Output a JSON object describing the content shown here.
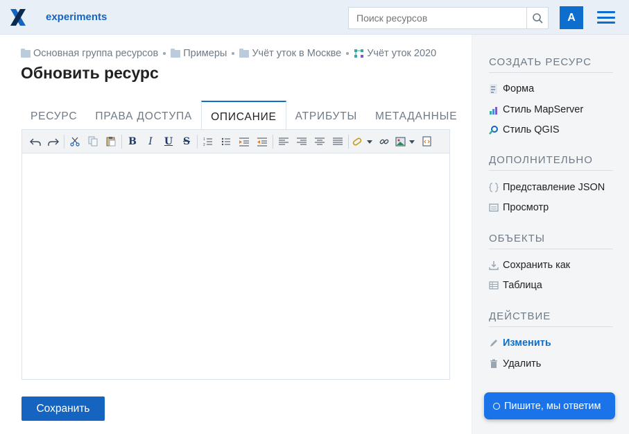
{
  "header": {
    "app_title": "experiments",
    "search_placeholder": "Поиск ресурсов",
    "avatar_letter": "A"
  },
  "breadcrumb": [
    {
      "label": "Основная группа ресурсов",
      "icon": "folder-icon"
    },
    {
      "label": "Примеры",
      "icon": "folder-icon"
    },
    {
      "label": "Учёт уток в Москве",
      "icon": "folder-icon"
    },
    {
      "label": "Учёт уток 2020",
      "icon": "vector-layer-icon"
    }
  ],
  "page_title": "Обновить ресурс",
  "tabs": [
    {
      "label": "РЕСУРС",
      "active": false
    },
    {
      "label": "ПРАВА ДОСТУПА",
      "active": false
    },
    {
      "label": "ОПИСАНИЕ",
      "active": true
    },
    {
      "label": "АТРИБУТЫ",
      "active": false
    },
    {
      "label": "МЕТАДАННЫЕ",
      "active": false
    }
  ],
  "toolbar": {
    "bold": "B",
    "italic": "I",
    "underline": "U",
    "strike": "S"
  },
  "save_label": "Сохранить",
  "sidebar": {
    "create_title": "СОЗДАТЬ РЕСУРС",
    "create_items": [
      {
        "label": "Форма",
        "icon": "form-icon"
      },
      {
        "label": "Стиль MapServer",
        "icon": "mapserver-style-icon"
      },
      {
        "label": "Стиль QGIS",
        "icon": "qgis-style-icon"
      }
    ],
    "extra_title": "ДОПОЛНИТЕЛЬНО",
    "extra_items": [
      {
        "label": "Представление JSON",
        "icon": "json-icon"
      },
      {
        "label": "Просмотр",
        "icon": "preview-icon"
      }
    ],
    "objects_title": "ОБЪЕКТЫ",
    "objects_items": [
      {
        "label": "Сохранить как",
        "icon": "download-icon"
      },
      {
        "label": "Таблица",
        "icon": "table-icon"
      }
    ],
    "action_title": "ДЕЙСТВИЕ",
    "action_items": [
      {
        "label": "Изменить",
        "icon": "pencil-icon",
        "active": true
      },
      {
        "label": "Удалить",
        "icon": "trash-icon",
        "active": false
      }
    ]
  },
  "chat_label": "Пишите, мы ответим",
  "colors": {
    "accent": "#0d6ecd",
    "header_bg": "#e9eff7",
    "sidebar_bg": "#f4f5f7"
  }
}
